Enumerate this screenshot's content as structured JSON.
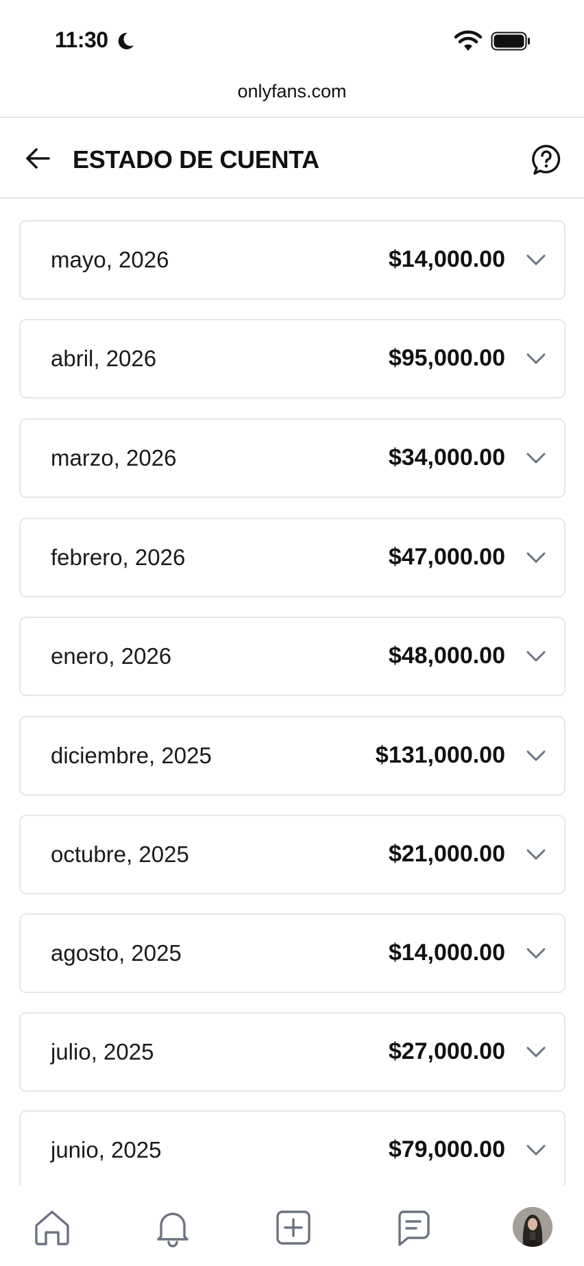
{
  "status_bar": {
    "time": "11:30"
  },
  "browser": {
    "url": "onlyfans.com"
  },
  "header": {
    "title": "ESTADO DE CUENTA"
  },
  "statements": [
    {
      "month": "mayo, 2026",
      "amount": "$14,000.00"
    },
    {
      "month": "abril, 2026",
      "amount": "$95,000.00"
    },
    {
      "month": "marzo, 2026",
      "amount": "$34,000.00"
    },
    {
      "month": "febrero, 2026",
      "amount": "$47,000.00"
    },
    {
      "month": "enero, 2026",
      "amount": "$48,000.00"
    },
    {
      "month": "diciembre, 2025",
      "amount": "$131,000.00"
    },
    {
      "month": "octubre, 2025",
      "amount": "$21,000.00"
    },
    {
      "month": "agosto, 2025",
      "amount": "$14,000.00"
    },
    {
      "month": "julio, 2025",
      "amount": "$27,000.00"
    },
    {
      "month": "junio, 2025",
      "amount": "$79,000.00"
    }
  ],
  "bottom_nav": {
    "items": [
      {
        "icon": "home-icon"
      },
      {
        "icon": "bell-icon"
      },
      {
        "icon": "add-post-icon"
      },
      {
        "icon": "messages-icon"
      },
      {
        "icon": "avatar"
      }
    ]
  },
  "colors": {
    "icon_gray": "#6b7280",
    "border": "#e6e7eb",
    "text": "#111111"
  }
}
